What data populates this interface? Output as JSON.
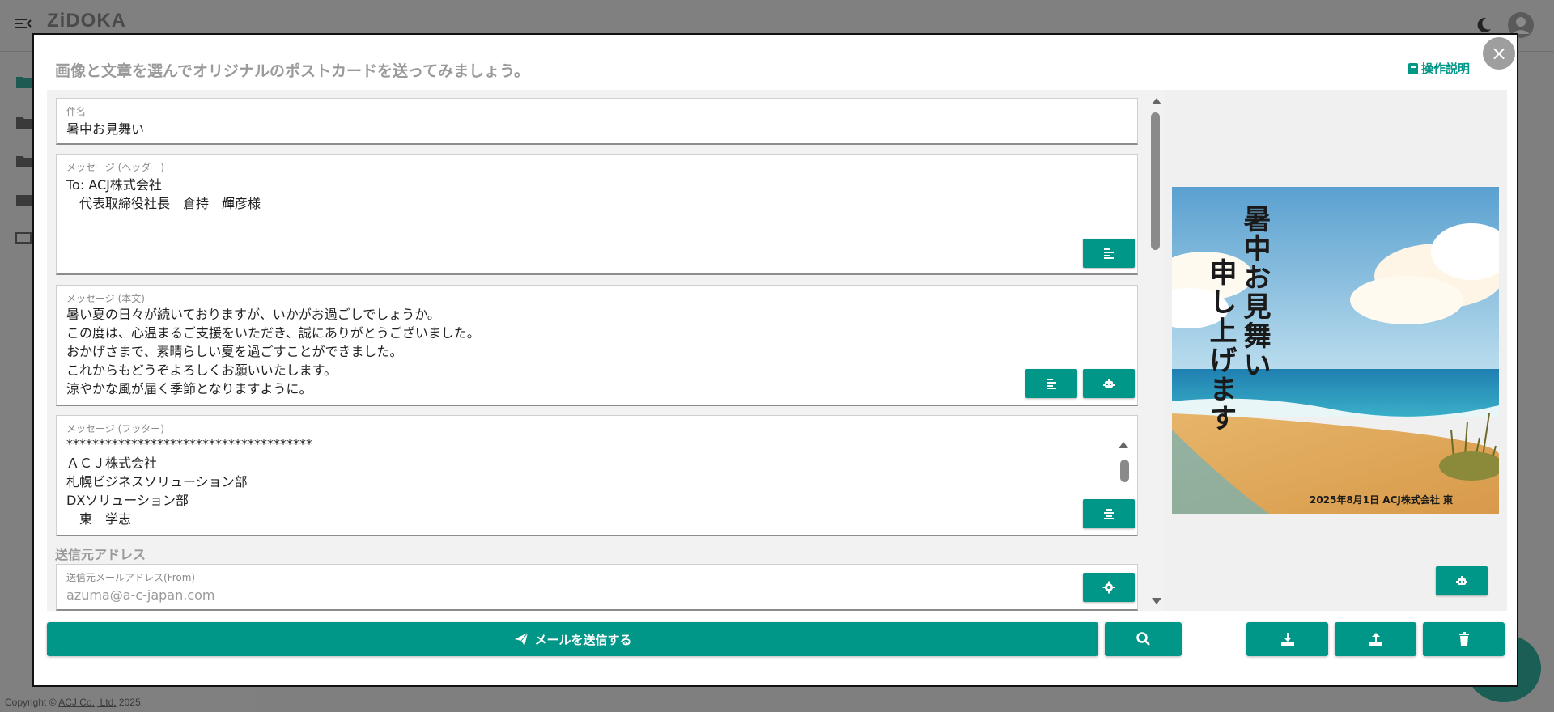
{
  "app": {
    "logo": "ZiDOKA",
    "copyright_prefix": "Copyright © ",
    "copyright_link": "ACJ Co., Ltd.",
    "copyright_suffix": " 2025."
  },
  "dialog": {
    "title": "画像と文章を選んでオリジナルのポストカードを送ってみましょう。",
    "help_link": "操作説明",
    "close_icon": "×"
  },
  "form": {
    "subject": {
      "label": "件名",
      "value": "暑中お見舞い"
    },
    "header_message": {
      "label": "メッセージ (ヘッダー)",
      "lines": [
        "To: ACJ株式会社",
        "　代表取締役社長　倉持　輝彦様"
      ]
    },
    "body_message": {
      "label": "メッセージ (本文)",
      "lines": [
        "暑い夏の日々が続いておりますが、いかがお過ごしでしょうか。",
        "この度は、心温まるご支援をいただき、誠にありがとうございました。",
        "おかげさまで、素晴らしい夏を過ごすことができました。",
        "これからもどうぞよろしくお願いいたします。",
        "涼やかな風が届く季節となりますように。"
      ]
    },
    "footer_message": {
      "label": "メッセージ (フッター)",
      "lines": [
        "**************************************",
        "ＡＣＪ株式会社",
        "札幌ビジネスソリューション部",
        "DXソリューション部",
        "　東　学志"
      ]
    },
    "sender_section_title": "送信元アドレス",
    "from": {
      "label": "送信元メールアドレス(From)",
      "placeholder": "azuma@a-c-japan.com"
    }
  },
  "preview": {
    "title_lines": [
      "暑中お見舞い",
      "申し上げます"
    ],
    "signature": "2025年8月1日  ACJ株式会社 東"
  },
  "actions": {
    "send_label": "メールを送信する"
  },
  "colors": {
    "accent": "#009688",
    "overlay": "#7f7f7f",
    "title_gray": "#9a9a9a"
  },
  "icons": {
    "menu": "menu-collapse-icon",
    "theme": "moon-icon",
    "account": "account-circle-icon",
    "close": "close-icon",
    "help": "book-icon",
    "align_left": "align-left-icon",
    "align_center": "align-center-icon",
    "robot": "robot-icon",
    "settings": "gear-icon",
    "send": "paper-plane-icon",
    "search": "search-icon",
    "download": "download-icon",
    "upload": "upload-icon",
    "trash": "trash-icon"
  }
}
